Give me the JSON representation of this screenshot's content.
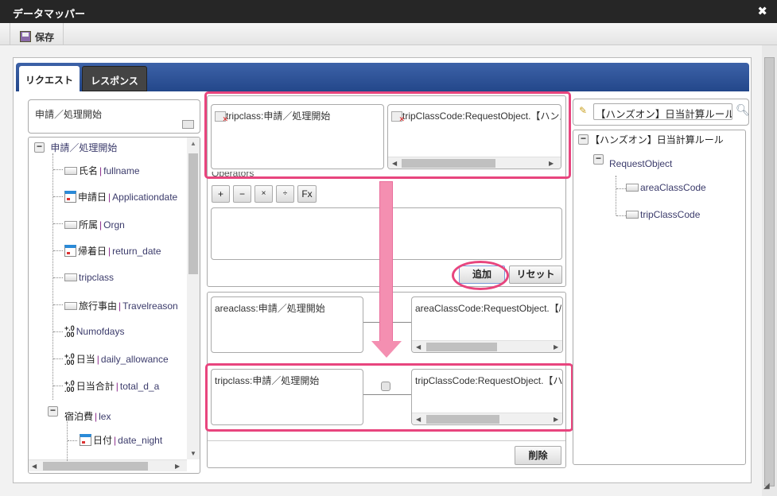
{
  "window": {
    "title": "データマッパー",
    "close_icon": "close-icon"
  },
  "toolbar": {
    "save_label": "保存"
  },
  "tabs": [
    {
      "label": "リクエスト",
      "active": true
    },
    {
      "label": "レスポンス",
      "active": false
    }
  ],
  "left": {
    "selected_value": "申請／処理開始",
    "tree": {
      "root": "申請／処理開始",
      "items": [
        {
          "name": "氏名",
          "id": "fullname",
          "type": "string"
        },
        {
          "name": "申請日",
          "id": "Applicationdate",
          "type": "date"
        },
        {
          "name": "所属",
          "id": "Orgn",
          "type": "string"
        },
        {
          "name": "帰着日",
          "id": "return_date",
          "type": "date"
        },
        {
          "name": "tripclass",
          "id": "",
          "type": "string"
        },
        {
          "name": "旅行事由",
          "id": "Travelreason",
          "type": "string"
        },
        {
          "name": "Numofdays",
          "id": "",
          "type": "number"
        },
        {
          "name": "日当",
          "id": "daily_allowance",
          "type": "number"
        },
        {
          "name": "日当合計",
          "id": "total_d_a",
          "type": "number"
        }
      ],
      "group": {
        "name": "宿泊費",
        "id": "lex",
        "children": [
          {
            "name": "日付",
            "id": "date_night",
            "type": "date"
          }
        ]
      },
      "separator": "|"
    }
  },
  "middle": {
    "source_selected": "tripclass:申請／処理開始",
    "target_selected": "tripClassCode:RequestObject.【ハンズ",
    "operators_label": "Operators",
    "operators": [
      "+",
      "−",
      "×",
      "÷",
      "Fx"
    ],
    "add_label": "追加",
    "reset_label": "リセット",
    "mappings": [
      {
        "source": "areaclass:申請／処理開始",
        "target": "areaClassCode:RequestObject.【/"
      },
      {
        "source": "tripclass:申請／処理開始",
        "target": "tripClassCode:RequestObject.【ハン"
      }
    ],
    "delete_label": "削除"
  },
  "right": {
    "search_value": "【ハンズオン】日当計算ルール",
    "tree": {
      "root": "【ハンズオン】日当計算ルール",
      "child": "RequestObject",
      "items": [
        "areaClassCode",
        "tripClassCode"
      ]
    }
  },
  "colors": {
    "highlight": "#e8457e",
    "arrow": "#f48fb1",
    "tab_bar": "#2f55a0"
  }
}
